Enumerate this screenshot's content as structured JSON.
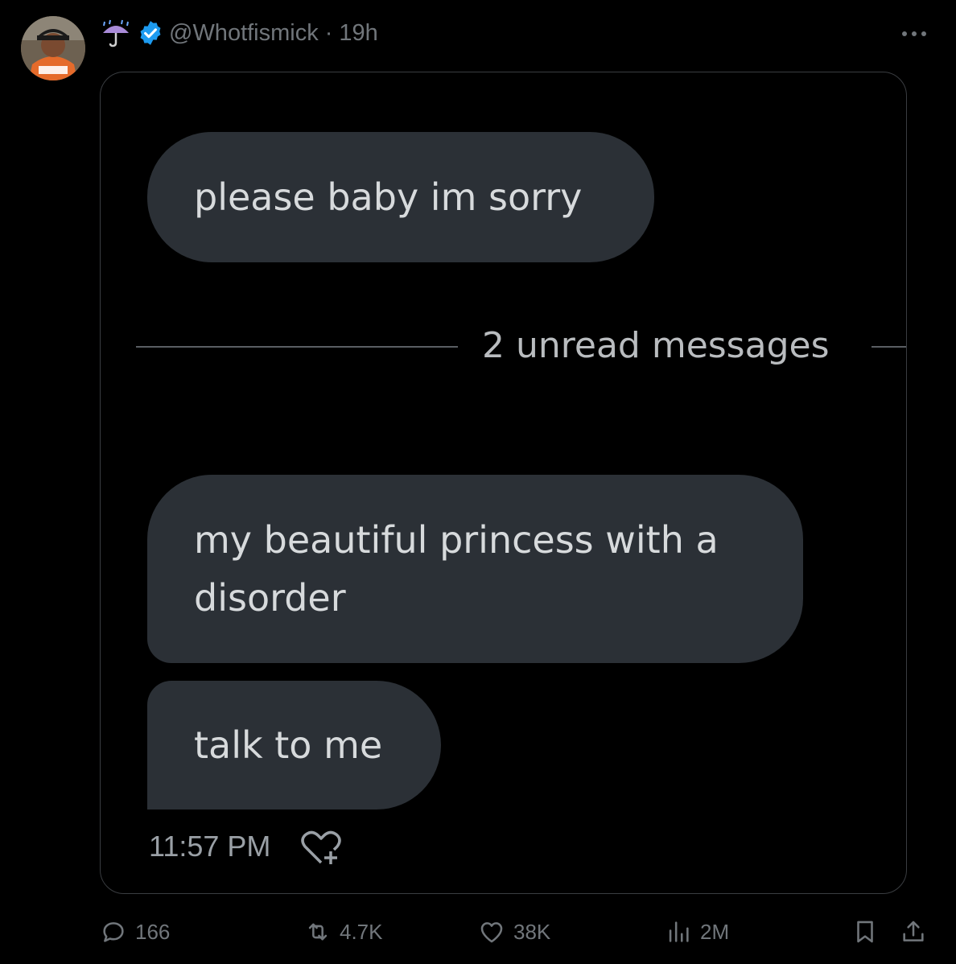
{
  "post": {
    "handle": "@Whotfismick",
    "separator": "·",
    "time_ago": "19h",
    "header_emoji": "umbrella-with-rain-icon",
    "verified_badge": "verified-badge-icon"
  },
  "media": {
    "message_1": "please baby im sorry",
    "unread_label": "2 unread messages",
    "message_2": "my beautiful princess with a disorder",
    "message_3": "talk to me",
    "timestamp": "11:57 PM",
    "reaction_icon": "heart-plus-icon"
  },
  "actions": {
    "replies": "166",
    "reposts": "4.7K",
    "likes": "38K",
    "views": "2M"
  },
  "colors": {
    "background": "#000000",
    "bubble": "#2b3036",
    "verified": "#1d9bf0",
    "muted_text": "#71767b"
  }
}
